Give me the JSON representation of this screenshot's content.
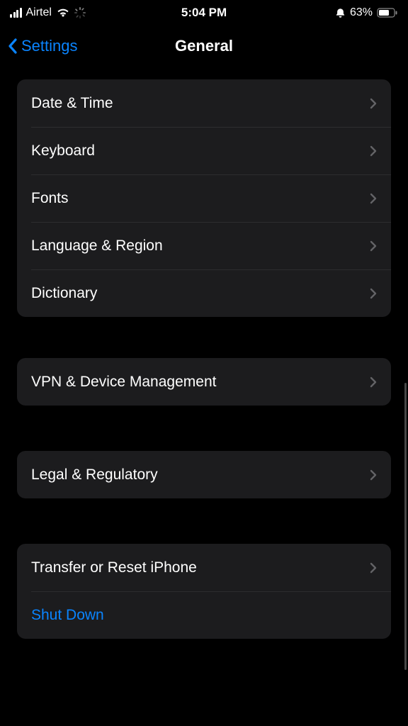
{
  "status": {
    "carrier": "Airtel",
    "time": "5:04 PM",
    "battery_pct": "63%"
  },
  "nav": {
    "back_label": "Settings",
    "title": "General"
  },
  "group1": {
    "items": [
      {
        "label": "Date & Time"
      },
      {
        "label": "Keyboard"
      },
      {
        "label": "Fonts"
      },
      {
        "label": "Language & Region"
      },
      {
        "label": "Dictionary"
      }
    ]
  },
  "group2": {
    "items": [
      {
        "label": "VPN & Device Management"
      }
    ]
  },
  "group3": {
    "items": [
      {
        "label": "Legal & Regulatory"
      }
    ]
  },
  "group4": {
    "items": [
      {
        "label": "Transfer or Reset iPhone"
      },
      {
        "label": "Shut Down"
      }
    ]
  }
}
